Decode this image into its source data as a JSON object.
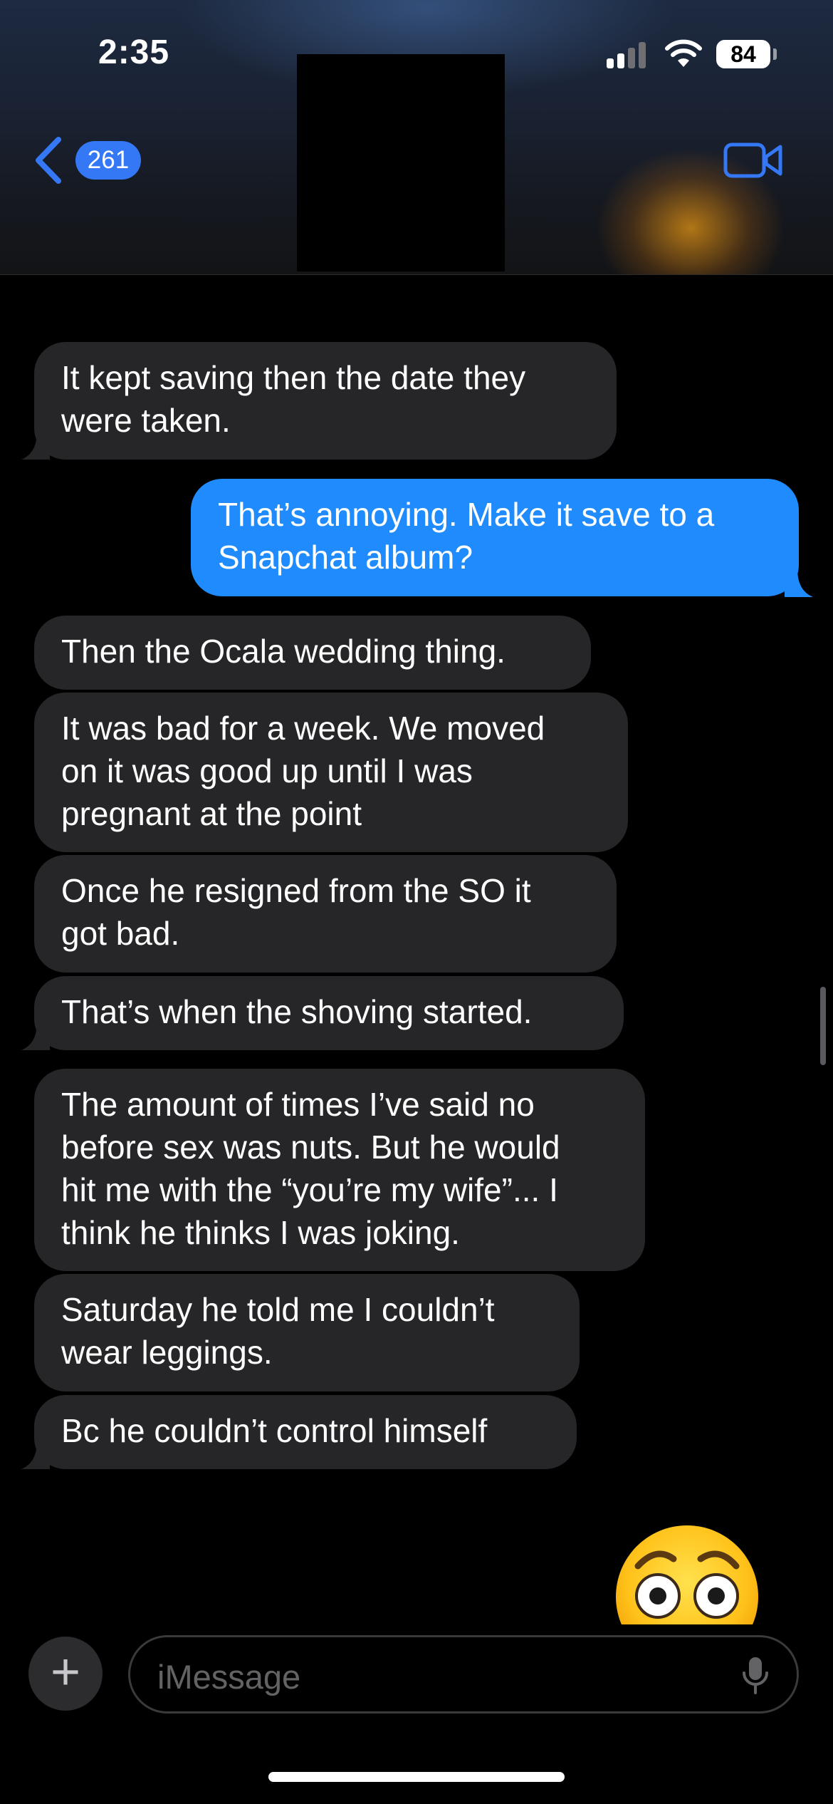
{
  "status_bar": {
    "time": "2:35",
    "battery": "84"
  },
  "nav": {
    "back_count": "261",
    "icons": [
      "chevron-left-icon",
      "video-call-icon"
    ]
  },
  "messages": [
    {
      "direction": "incoming",
      "text": "It kept saving then the date they\nwere taken."
    },
    {
      "direction": "outgoing",
      "text": "That’s annoying. Make it save to a\nSnapchat album?"
    },
    {
      "direction": "incoming",
      "text": "Then the Ocala wedding thing."
    },
    {
      "direction": "incoming",
      "text": "It was bad for a week. We moved\non it was good up until I was\npregnant at the point"
    },
    {
      "direction": "incoming",
      "text": "Once he resigned from the SO it\ngot bad."
    },
    {
      "direction": "incoming",
      "text": "That’s when the shoving started."
    },
    {
      "direction": "incoming",
      "text": "The amount of times I’ve said no\nbefore sex was nuts. But he would\nhit me with the “you’re my wife”... I\nthink he thinks I was joking."
    },
    {
      "direction": "incoming",
      "text": "Saturday he told me I couldn’t\nwear leggings."
    },
    {
      "direction": "incoming",
      "text": "Bc he couldn’t control himself"
    }
  ],
  "reaction_emoji": "flushed-face-icon",
  "composer": {
    "placeholder": "iMessage",
    "plus_label": "+"
  },
  "colors": {
    "incoming_bubble": "#262628",
    "outgoing_bubble": "#1f8bfd",
    "accent": "#3478f6"
  }
}
